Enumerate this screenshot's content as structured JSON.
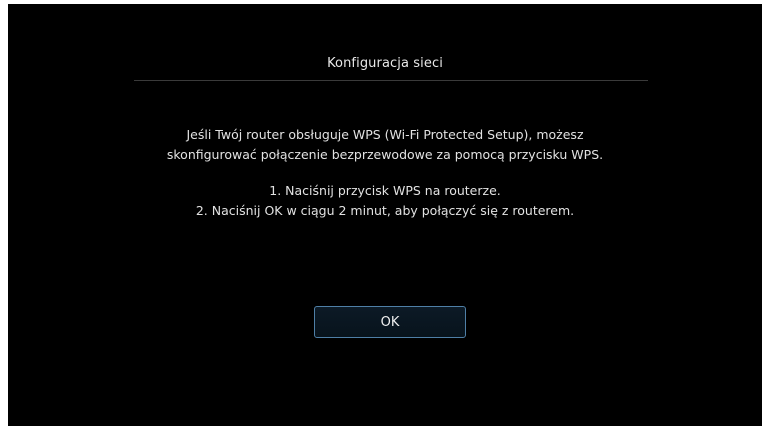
{
  "dialog": {
    "title": "Konfiguracja sieci",
    "description_line1": "Jeśli Twój router obsługuje WPS (Wi-Fi Protected Setup), możesz",
    "description_line2": "skonfigurować połączenie bezprzewodowe za pomocą przycisku WPS.",
    "step1": "1. Naciśnij przycisk WPS na routerze.",
    "step2": "2. Naciśnij OK w ciągu 2 minut, aby połączyć się z routerem.",
    "ok_label": "OK"
  },
  "colors": {
    "background": "#000000",
    "text": "#e6e6e6",
    "button_border": "#4f7fa6",
    "divider": "#3a3a3a"
  }
}
